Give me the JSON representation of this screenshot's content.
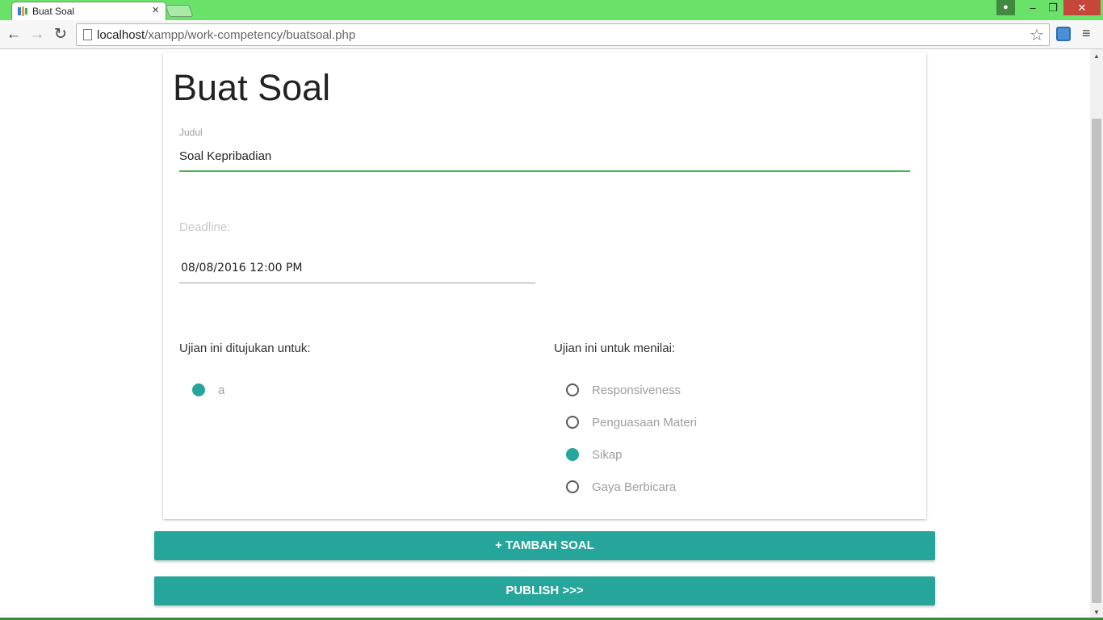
{
  "browser": {
    "tab_title": "Buat Soal",
    "tab_close": "×",
    "url_host": "localhost",
    "url_path": "/xampp/work-competency/buatsoal.php",
    "win_min": "‒",
    "win_max": "❐",
    "win_close": "✕",
    "back": "←",
    "forward": "→",
    "reload": "↻",
    "star": "☆",
    "menu": "≡"
  },
  "page": {
    "title": "Buat Soal",
    "judul_label": "Judul",
    "judul_value": "Soal Kepribadian",
    "deadline_label": "Deadline:",
    "deadline_value": "08/08/2016 12:00 PM",
    "target_label": "Ujian ini ditujukan untuk:",
    "target_options": [
      {
        "label": "a",
        "checked": true
      }
    ],
    "assess_label": "Ujian ini untuk menilai:",
    "assess_options": [
      {
        "label": "Responsiveness",
        "checked": false
      },
      {
        "label": "Penguasaan Materi",
        "checked": false
      },
      {
        "label": "Sikap",
        "checked": true
      },
      {
        "label": "Gaya Berbicara",
        "checked": false
      }
    ],
    "add_button": "+ TAMBAH SOAL",
    "publish_button": "PUBLISH >>>"
  },
  "colors": {
    "tab_bar": "#6ae26a",
    "accent": "#26a69a",
    "input_focus": "#4caf50"
  }
}
